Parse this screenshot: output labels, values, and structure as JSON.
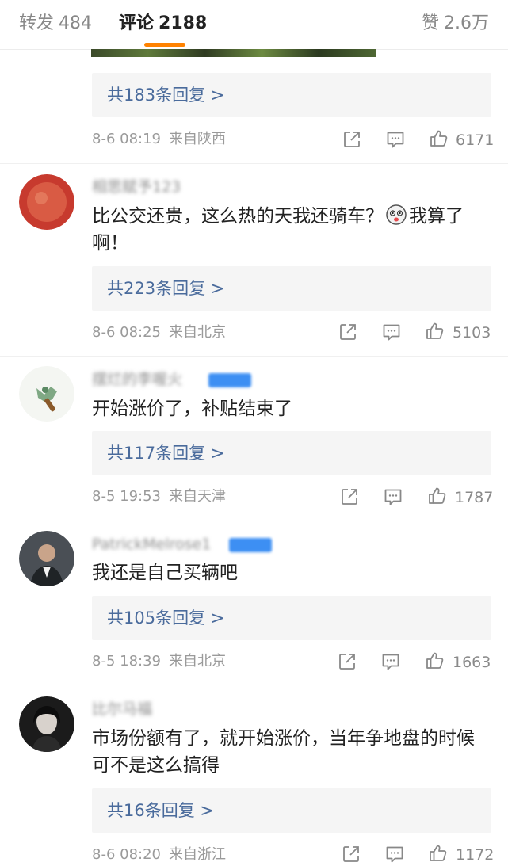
{
  "tabs": {
    "repost_label": "转发",
    "repost_count": "484",
    "comments_label": "评论",
    "comments_count": "2188",
    "likes_label": "赞",
    "likes_count": "2.6万"
  },
  "accent_color": "#ff8200",
  "link_color": "#4a6b9c",
  "top_comment": {
    "reply_text": "共183条回复 >",
    "time": "8-6 08:19",
    "source": "来自陕西",
    "likes": "6171"
  },
  "comments": [
    {
      "username": "相思赋予123",
      "text_part1": "比公交还贵，这么热的天我还骑车？",
      "emoji": "face-emoji",
      "text_part2": "我算了啊！",
      "reply_text": "共223条回复 >",
      "time": "8-6 08:25",
      "source": "来自北京",
      "likes": "5103"
    },
    {
      "username": "摆烂的李喔火",
      "text": "开始涨价了，补贴结束了",
      "reply_text": "共117条回复 >",
      "time": "8-5 19:53",
      "source": "来自天津",
      "likes": "1787"
    },
    {
      "username": "PatrickMelrose1",
      "text": "我还是自己买辆吧",
      "reply_text": "共105条回复 >",
      "time": "8-5 18:39",
      "source": "来自北京",
      "likes": "1663"
    },
    {
      "username": "比尔马福",
      "text": "市场份额有了，就开始涨价，当年争地盘的时候可不是这么搞得",
      "reply_text": "共16条回复 >",
      "time": "8-6 08:20",
      "source": "来自浙江",
      "likes": "1172"
    }
  ],
  "icons": [
    "share-icon",
    "comment-icon",
    "like-icon"
  ]
}
